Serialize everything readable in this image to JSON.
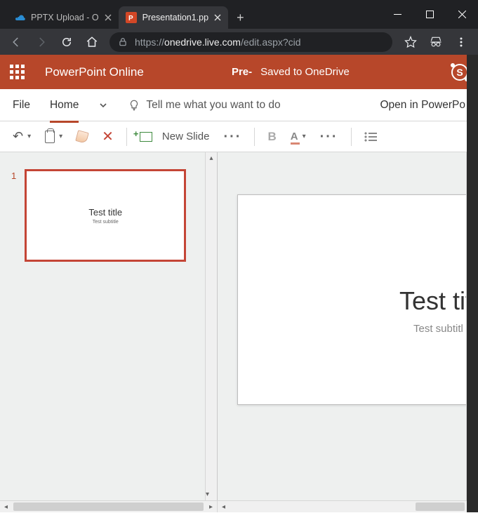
{
  "browser": {
    "tabs": [
      {
        "label": "PPTX Upload - O",
        "favicon": "onedrive"
      },
      {
        "label": "Presentation1.pp",
        "favicon": "powerpoint"
      }
    ],
    "active_tab_index": 1,
    "url_prefix": "https://",
    "url_domain": "onedrive.live.com",
    "url_path": "/edit.aspx?cid"
  },
  "app": {
    "name": "PowerPoint Online",
    "doc_title": "Pre-",
    "saved_status": "Saved to OneDrive",
    "skype_label": "S"
  },
  "ribbon": {
    "tabs": {
      "file": "File",
      "home": "Home"
    },
    "tell_me": "Tell me what you want to do",
    "open_desktop": "Open in PowerPo"
  },
  "toolbar": {
    "new_slide": "New Slide",
    "bold": "B"
  },
  "slides": [
    {
      "number": "1",
      "title": "Test title",
      "subtitle": "Test subtitle"
    }
  ],
  "canvas": {
    "title": "Test tit",
    "subtitle": "Test subtitl"
  }
}
